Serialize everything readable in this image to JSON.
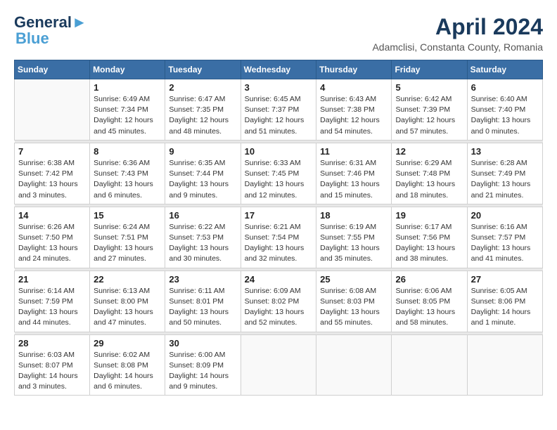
{
  "header": {
    "logo_line1": "General",
    "logo_line2": "Blue",
    "month_year": "April 2024",
    "location": "Adamclisi, Constanta County, Romania"
  },
  "days_of_week": [
    "Sunday",
    "Monday",
    "Tuesday",
    "Wednesday",
    "Thursday",
    "Friday",
    "Saturday"
  ],
  "weeks": [
    [
      {
        "day": "",
        "info": ""
      },
      {
        "day": "1",
        "info": "Sunrise: 6:49 AM\nSunset: 7:34 PM\nDaylight: 12 hours\nand 45 minutes."
      },
      {
        "day": "2",
        "info": "Sunrise: 6:47 AM\nSunset: 7:35 PM\nDaylight: 12 hours\nand 48 minutes."
      },
      {
        "day": "3",
        "info": "Sunrise: 6:45 AM\nSunset: 7:37 PM\nDaylight: 12 hours\nand 51 minutes."
      },
      {
        "day": "4",
        "info": "Sunrise: 6:43 AM\nSunset: 7:38 PM\nDaylight: 12 hours\nand 54 minutes."
      },
      {
        "day": "5",
        "info": "Sunrise: 6:42 AM\nSunset: 7:39 PM\nDaylight: 12 hours\nand 57 minutes."
      },
      {
        "day": "6",
        "info": "Sunrise: 6:40 AM\nSunset: 7:40 PM\nDaylight: 13 hours\nand 0 minutes."
      }
    ],
    [
      {
        "day": "7",
        "info": "Sunrise: 6:38 AM\nSunset: 7:42 PM\nDaylight: 13 hours\nand 3 minutes."
      },
      {
        "day": "8",
        "info": "Sunrise: 6:36 AM\nSunset: 7:43 PM\nDaylight: 13 hours\nand 6 minutes."
      },
      {
        "day": "9",
        "info": "Sunrise: 6:35 AM\nSunset: 7:44 PM\nDaylight: 13 hours\nand 9 minutes."
      },
      {
        "day": "10",
        "info": "Sunrise: 6:33 AM\nSunset: 7:45 PM\nDaylight: 13 hours\nand 12 minutes."
      },
      {
        "day": "11",
        "info": "Sunrise: 6:31 AM\nSunset: 7:46 PM\nDaylight: 13 hours\nand 15 minutes."
      },
      {
        "day": "12",
        "info": "Sunrise: 6:29 AM\nSunset: 7:48 PM\nDaylight: 13 hours\nand 18 minutes."
      },
      {
        "day": "13",
        "info": "Sunrise: 6:28 AM\nSunset: 7:49 PM\nDaylight: 13 hours\nand 21 minutes."
      }
    ],
    [
      {
        "day": "14",
        "info": "Sunrise: 6:26 AM\nSunset: 7:50 PM\nDaylight: 13 hours\nand 24 minutes."
      },
      {
        "day": "15",
        "info": "Sunrise: 6:24 AM\nSunset: 7:51 PM\nDaylight: 13 hours\nand 27 minutes."
      },
      {
        "day": "16",
        "info": "Sunrise: 6:22 AM\nSunset: 7:53 PM\nDaylight: 13 hours\nand 30 minutes."
      },
      {
        "day": "17",
        "info": "Sunrise: 6:21 AM\nSunset: 7:54 PM\nDaylight: 13 hours\nand 32 minutes."
      },
      {
        "day": "18",
        "info": "Sunrise: 6:19 AM\nSunset: 7:55 PM\nDaylight: 13 hours\nand 35 minutes."
      },
      {
        "day": "19",
        "info": "Sunrise: 6:17 AM\nSunset: 7:56 PM\nDaylight: 13 hours\nand 38 minutes."
      },
      {
        "day": "20",
        "info": "Sunrise: 6:16 AM\nSunset: 7:57 PM\nDaylight: 13 hours\nand 41 minutes."
      }
    ],
    [
      {
        "day": "21",
        "info": "Sunrise: 6:14 AM\nSunset: 7:59 PM\nDaylight: 13 hours\nand 44 minutes."
      },
      {
        "day": "22",
        "info": "Sunrise: 6:13 AM\nSunset: 8:00 PM\nDaylight: 13 hours\nand 47 minutes."
      },
      {
        "day": "23",
        "info": "Sunrise: 6:11 AM\nSunset: 8:01 PM\nDaylight: 13 hours\nand 50 minutes."
      },
      {
        "day": "24",
        "info": "Sunrise: 6:09 AM\nSunset: 8:02 PM\nDaylight: 13 hours\nand 52 minutes."
      },
      {
        "day": "25",
        "info": "Sunrise: 6:08 AM\nSunset: 8:03 PM\nDaylight: 13 hours\nand 55 minutes."
      },
      {
        "day": "26",
        "info": "Sunrise: 6:06 AM\nSunset: 8:05 PM\nDaylight: 13 hours\nand 58 minutes."
      },
      {
        "day": "27",
        "info": "Sunrise: 6:05 AM\nSunset: 8:06 PM\nDaylight: 14 hours\nand 1 minute."
      }
    ],
    [
      {
        "day": "28",
        "info": "Sunrise: 6:03 AM\nSunset: 8:07 PM\nDaylight: 14 hours\nand 3 minutes."
      },
      {
        "day": "29",
        "info": "Sunrise: 6:02 AM\nSunset: 8:08 PM\nDaylight: 14 hours\nand 6 minutes."
      },
      {
        "day": "30",
        "info": "Sunrise: 6:00 AM\nSunset: 8:09 PM\nDaylight: 14 hours\nand 9 minutes."
      },
      {
        "day": "",
        "info": ""
      },
      {
        "day": "",
        "info": ""
      },
      {
        "day": "",
        "info": ""
      },
      {
        "day": "",
        "info": ""
      }
    ]
  ]
}
